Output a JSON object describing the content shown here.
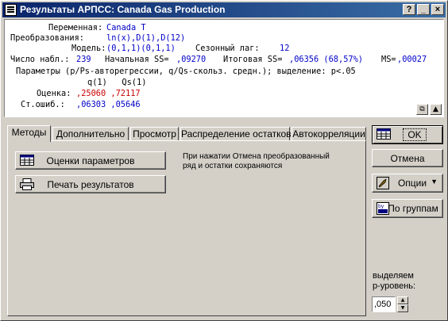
{
  "window": {
    "title": "Результаты АРПСС: Canada Gas Production",
    "help_label": "?",
    "minimize_label": "_",
    "close_label": "×"
  },
  "output": {
    "variable_label": "Переменная:",
    "variable_value": "Canada T",
    "transform_label": "Преобразования:",
    "transform_value": "ln(x),D(1),D(12)",
    "model_label": "Модель:",
    "model_value": "(0,1,1)(0,1,1)",
    "seasonal_lag_label": "Сезонный лаг:",
    "seasonal_lag_value": "12",
    "nobs_label": "Число набл.:",
    "nobs_value": "239",
    "initial_ss_label": "Начальная SS=",
    "initial_ss_value": ",09270",
    "final_ss_label": "Итоговая SS=",
    "final_ss_value": ",06356 (68,57%)",
    "ms_label": "MS=",
    "ms_value": ",00027",
    "params_line": "Параметры (p/Ps-авторегрессии, q/Qs-скольз. средн.); выделение: p<.05",
    "col_headers": "q(1)   Qs(1)",
    "estimate_label": "Оценка:",
    "estimate_values": ",25060 ,72117",
    "stderr_label": "Ст.ошиб.:",
    "stderr_values": ",06303 ,05646"
  },
  "tabs": [
    {
      "label": "Методы"
    },
    {
      "label": "Дополнительно"
    },
    {
      "label": "Просмотр"
    },
    {
      "label": "Распределение остатков"
    },
    {
      "label": "Автокорреляции"
    }
  ],
  "panel": {
    "estimates_button": "Оценки параметров",
    "print_button": "Печать результатов",
    "note": "При нажатии Отмена преобразованный ряд и остатки сохраняются"
  },
  "side": {
    "ok_label": "OK",
    "cancel_label": "Отмена",
    "options_label": "Опции",
    "bygroup_label": "По группам",
    "p_label_line1": "выделяем",
    "p_label_line2": "p-уровень:",
    "p_value": ",050"
  },
  "colors": {
    "title_start": "#0a246a",
    "title_end": "#3a6ea5",
    "value_blue": "#0000c8",
    "value_red": "#c80000"
  }
}
